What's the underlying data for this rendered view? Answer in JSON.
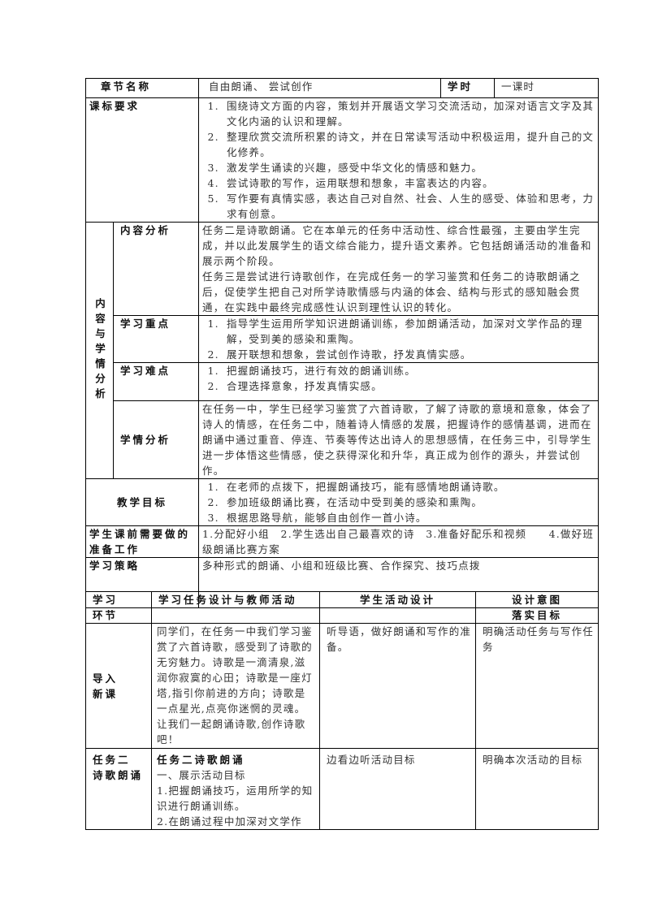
{
  "header": {
    "chapter_label": "章节名称",
    "chapter_value": "自由朗诵、 尝试创作",
    "hours_label": "学时",
    "hours_value": "一课时"
  },
  "curriculum": {
    "label": "课标要求",
    "items": [
      "围绕诗文方面的内容，策划并开展语文学习交流活动，加深对语言文字及其文化内涵的认识和理解。",
      "整理欣赏交流所积累的诗文，并在日常读写活动中积极运用，提升自己的文化修养。",
      "激发学生诵读的兴趣，感受中华文化的情感和魅力。",
      "尝试诗歌的写作，运用联想和想象，丰富表达的内容。",
      "写作要有真情实感，表达自己对自然、社会、人生的感受、体验和思考，力求有创意。"
    ]
  },
  "analysis": {
    "group_label": "内容与学情分析",
    "content": {
      "label": "内容分析",
      "paragraphs": [
        "任务二是诗歌朗诵。它在本单元的任务中活动性、综合性最强，主要由学生完成，并以此发展学生的语文综合能力，提升语文素养。它包括朗诵活动的准备和展示两个阶段。",
        "任务三是尝试进行诗歌创作，在完成任务一的学习鉴赏和任务二的诗歌朗诵之后，促使学生把自己对所学诗歌情感与内涵的体会、结构与形式的感知融会贯通，在实践中最终完成感性认识到理性认识的转化。"
      ]
    },
    "key_points": {
      "label": "学习重点",
      "items": [
        "指导学生运用所学知识进朗诵训练，参加朗诵活动，加深对文学作品的理解，受到美的感染和熏陶。",
        "展开联想和想象，尝试创作诗歌，抒发真情实感。"
      ]
    },
    "difficulties": {
      "label": "学习难点",
      "items": [
        "把握朗诵技巧，进行有效的朗诵训练。",
        "合理选择意象，抒发真情实感。"
      ]
    },
    "students": {
      "label": "学情分析",
      "text": "在任务一中，学生已经学习鉴赏了六首诗歌，了解了诗歌的意境和意象，体会了诗人的情感，在任务二中，随着诗人情感的发展，把握诗作的感情基调，进而在朗诵中通过重音、停连、节奏等传达出诗人的思想感情，在任务三中，引导学生进一步体悟这些情感，使之获得深化和升华，真正成为创作的源头，并尝试创作。"
    }
  },
  "objectives": {
    "label": "教学目标",
    "items": [
      "在老师的点拨下，把握朗诵技巧，能有感情地朗诵诗歌。",
      "参加班级朗诵比赛，在活动中受到美的感染和熏陶。",
      "根据思路导航，能够自由创作一首小诗。"
    ]
  },
  "preparation": {
    "label": "学生课前需要做的准备工作",
    "text": "1.分配好小组　2.学生选出自己最喜欢的诗　3.准备好配乐和视频　　4.做好班级朗诵比赛方案"
  },
  "strategy": {
    "label": "学习策略",
    "text": "多种形式的朗诵、小组和班级比赛、合作探究、技巧点拨"
  },
  "process": {
    "headers": [
      "学习环节",
      "学习任务设计与教师活动",
      "学生活动设计",
      "设计意图落实目标"
    ],
    "header_lines": {
      "col1": [
        "学习",
        "环节"
      ],
      "col4": [
        "设计意图",
        "落实目标"
      ]
    },
    "rows": [
      {
        "stage_lines": [
          "导入",
          "新课"
        ],
        "teacher": "同学们，在任务一中我们学习鉴赏了六首诗歌，感受到了诗歌的无穷魅力。诗歌是一滴清泉,滋润你寂寞的心田；诗歌是一座灯塔,指引你前进的方向；诗歌是一点星光,点亮你迷惘的灵魂。让我们一起朗诵诗歌,创作诗歌吧！",
        "student": "听导语，做好朗诵和写作的准备。",
        "intent": "明确活动任务与写作任务"
      },
      {
        "stage_lines": [
          "任务二",
          "诗歌朗诵"
        ],
        "teacher_title": "任务二诗歌朗诵",
        "teacher_lines": [
          "一、展示活动目标",
          "1.把握朗诵技巧，运用所学的知识进行朗诵训练。",
          "2.在朗诵过程中加深对文学作"
        ],
        "student": "边看边听活动目标",
        "intent": "明确本次活动的目标"
      }
    ]
  }
}
